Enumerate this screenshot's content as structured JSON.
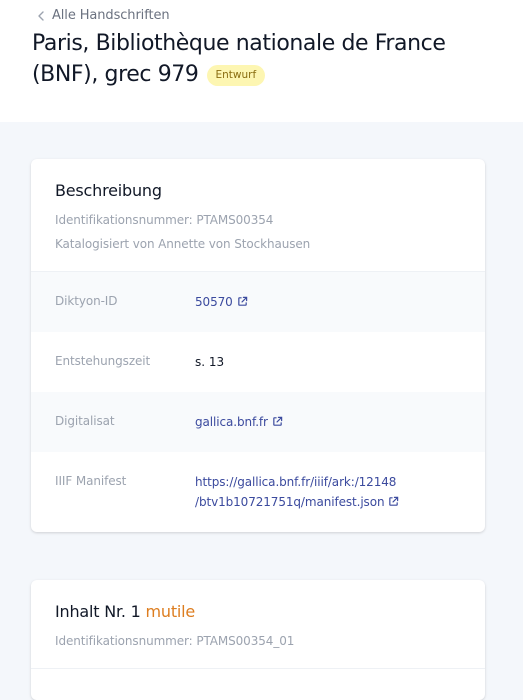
{
  "nav": {
    "back_label": "Alle Handschriften"
  },
  "page": {
    "title": "Paris, Bibliothèque nationale de France (BNF), grec 979",
    "status_badge": "Entwurf"
  },
  "description_card": {
    "heading": "Beschreibung",
    "id_line": "Identifikationsnummer: PTAMS00354",
    "cataloged_by": "Katalogisiert von Annette von Stockhausen",
    "rows": [
      {
        "label": "Diktyon-ID",
        "value": "50570",
        "link": true
      },
      {
        "label": "Entstehungszeit",
        "value": "s. 13",
        "link": false
      },
      {
        "label": "Digitalisat",
        "value": "gallica.bnf.fr",
        "link": true
      },
      {
        "label": "IIIF Manifest",
        "value_line1": "https://gallica.bnf.fr/iiif/ark:/12148",
        "value_line2": "/btv1b10721751q/manifest.json",
        "link": true
      }
    ]
  },
  "content_card": {
    "heading_prefix": "Inhalt Nr. 1",
    "heading_tag": "mutile",
    "id_line": "Identifikationsnummer: PTAMS00354_01"
  },
  "colors": {
    "background": "#f4f7fb",
    "link": "#3b4a9e",
    "badge_bg": "#fdf6b2",
    "badge_text": "#8a6d11",
    "mutile": "#dd7d1f"
  }
}
